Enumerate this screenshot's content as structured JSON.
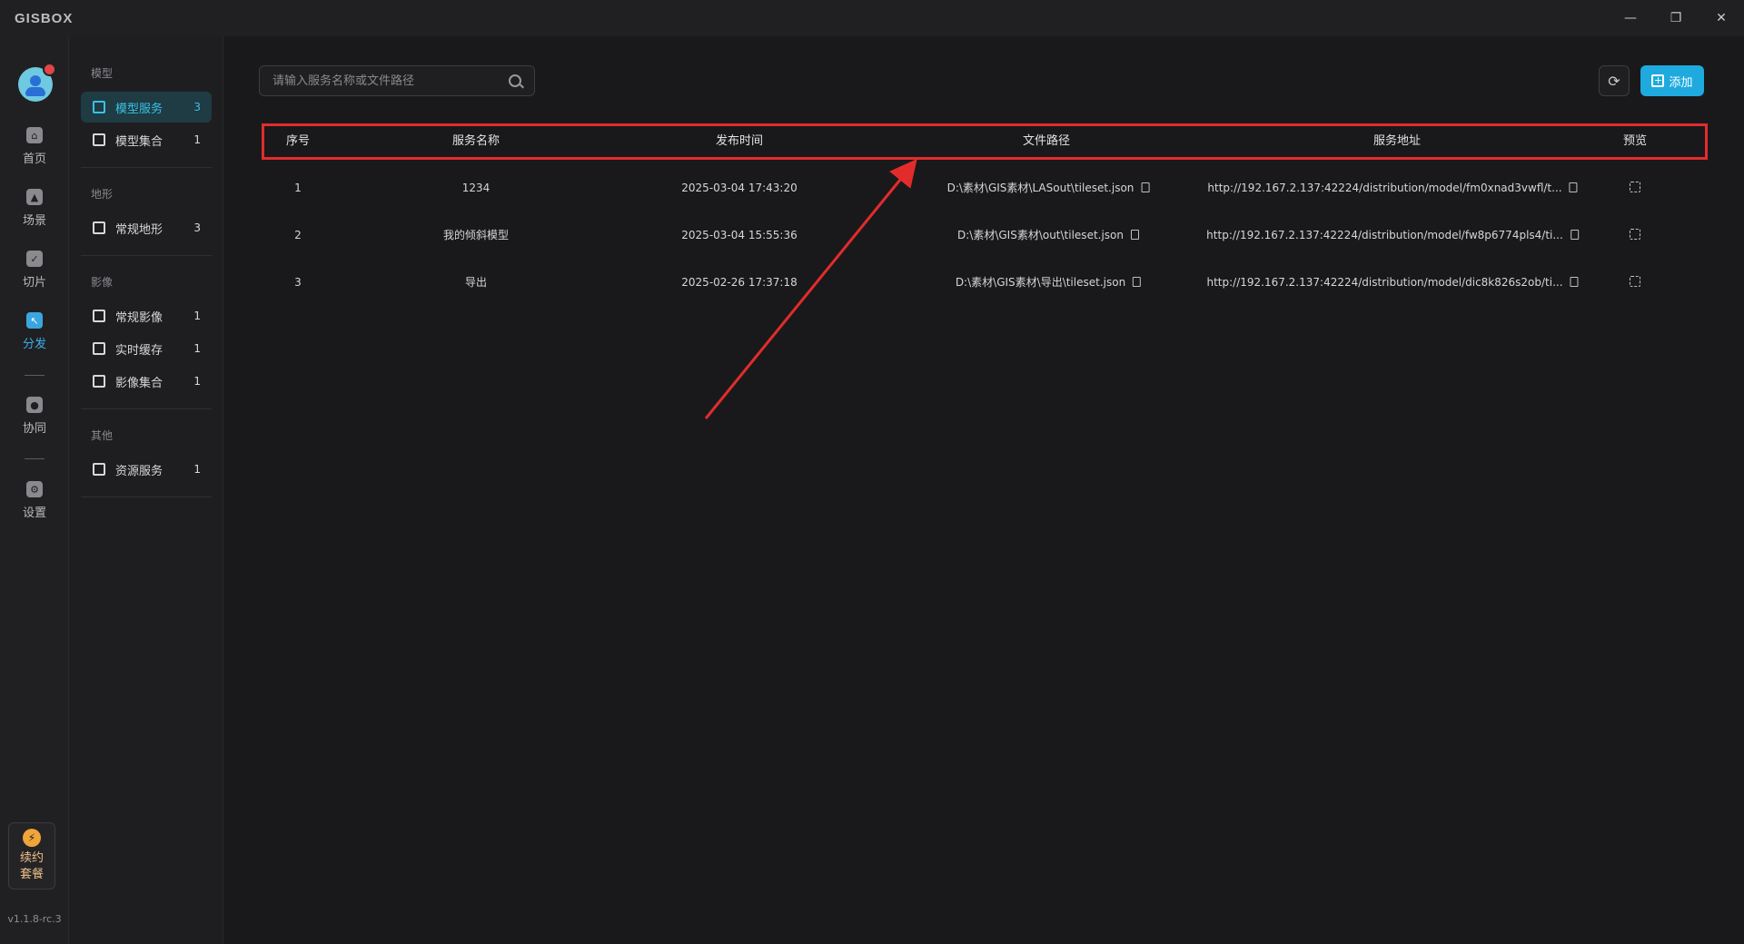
{
  "app": {
    "logo": "GISBOX"
  },
  "window": {
    "minimize": "—",
    "restore": "❐",
    "close": "✕"
  },
  "rail": {
    "items": [
      {
        "label": "首页",
        "icon": "home-icon"
      },
      {
        "label": "场景",
        "icon": "scene-icon"
      },
      {
        "label": "切片",
        "icon": "slice-icon"
      },
      {
        "label": "分发",
        "icon": "distribute-icon"
      },
      {
        "label": "协同",
        "icon": "collab-icon"
      },
      {
        "label": "设置",
        "icon": "settings-icon"
      }
    ],
    "renew": {
      "line1": "续约",
      "line2": "套餐",
      "icon": "⚡"
    },
    "version": "v1.1.8-rc.3"
  },
  "sidebar": {
    "groups": [
      {
        "title": "模型",
        "items": [
          {
            "label": "模型服务",
            "count": "3"
          },
          {
            "label": "模型集合",
            "count": "1"
          }
        ]
      },
      {
        "title": "地形",
        "items": [
          {
            "label": "常规地形",
            "count": "3"
          }
        ]
      },
      {
        "title": "影像",
        "items": [
          {
            "label": "常规影像",
            "count": "1"
          },
          {
            "label": "实时缓存",
            "count": "1"
          },
          {
            "label": "影像集合",
            "count": "1"
          }
        ]
      },
      {
        "title": "其他",
        "items": [
          {
            "label": "资源服务",
            "count": "1"
          }
        ]
      }
    ]
  },
  "toolbar": {
    "search_placeholder": "请输入服务名称或文件路径",
    "refresh_icon": "⟳",
    "add_label": "添加",
    "add_icon": "+"
  },
  "table": {
    "headers": [
      "序号",
      "服务名称",
      "发布时间",
      "文件路径",
      "服务地址",
      "预览"
    ],
    "rows": [
      {
        "index": "1",
        "name": "1234",
        "time": "2025-03-04 17:43:20",
        "path": "D:\\素材\\GIS素材\\LASout\\tileset.json",
        "url": "http://192.167.2.137:42224/distribution/model/fm0xnad3vwfl/t..."
      },
      {
        "index": "2",
        "name": "我的倾斜模型",
        "time": "2025-03-04 15:55:36",
        "path": "D:\\素材\\GIS素材\\out\\tileset.json",
        "url": "http://192.167.2.137:42224/distribution/model/fw8p6774pls4/ti..."
      },
      {
        "index": "3",
        "name": "导出",
        "time": "2025-02-26 17:37:18",
        "path": "D:\\素材\\GIS素材\\导出\\tileset.json",
        "url": "http://192.167.2.137:42224/distribution/model/dic8k826s2ob/ti..."
      }
    ]
  },
  "colors": {
    "accent": "#1eaadf",
    "highlight_box": "#e22c2c",
    "arrow": "#e22c2c"
  }
}
